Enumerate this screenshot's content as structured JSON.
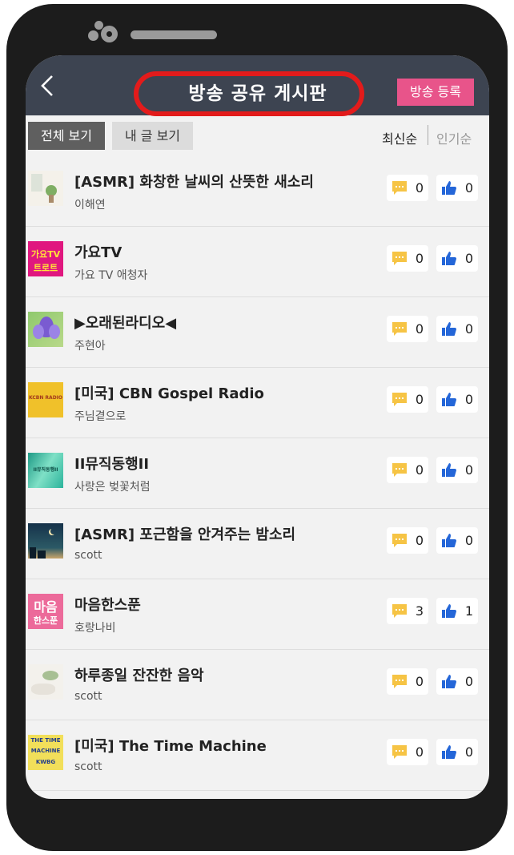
{
  "header": {
    "back_icon": "chevron-left-icon",
    "title": "방송 공유 게시판",
    "register_label": "방송 등록"
  },
  "tabs": {
    "all": "전체 보기",
    "mine": "내 글 보기"
  },
  "sort": {
    "latest": "최신순",
    "popular": "인기순"
  },
  "colors": {
    "header_bg": "#3d4451",
    "accent_pink": "#e8548a",
    "comment_icon": "#f6c445",
    "like_icon": "#2466d8",
    "highlight_ring": "#e31b1b"
  },
  "items": [
    {
      "title": "[ASMR] 화창한 날씨의 산뜻한 새소리",
      "author": "이해연",
      "comments": "0",
      "likes": "0"
    },
    {
      "title": "가요TV",
      "author": "가요 TV 애청자",
      "comments": "0",
      "likes": "0",
      "thumb_text": [
        "가요TV",
        "트로트"
      ]
    },
    {
      "title": "▶오래된라디오◀",
      "author": "주현아",
      "comments": "0",
      "likes": "0"
    },
    {
      "title": "[미국] CBN Gospel Radio",
      "author": "주님곁으로",
      "comments": "0",
      "likes": "0",
      "thumb_text": [
        "KCBN RADIO"
      ]
    },
    {
      "title": "II뮤직동행II",
      "author": "사랑은 벚꽃처럼",
      "comments": "0",
      "likes": "0",
      "thumb_text": [
        "II뮤직동행II"
      ]
    },
    {
      "title": "[ASMR] 포근함을 안겨주는 밤소리",
      "author": "scott",
      "comments": "0",
      "likes": "0"
    },
    {
      "title": "마음한스푼",
      "author": "호랑나비",
      "comments": "3",
      "likes": "1",
      "thumb_text": [
        "마음",
        "한스푼"
      ]
    },
    {
      "title": "하루종일 잔잔한 음악",
      "author": "scott",
      "comments": "0",
      "likes": "0"
    },
    {
      "title": "[미국] The Time Machine",
      "author": "scott",
      "comments": "0",
      "likes": "0",
      "thumb_text": [
        "THE TIME",
        "MACHINE",
        "KWBG"
      ]
    }
  ]
}
